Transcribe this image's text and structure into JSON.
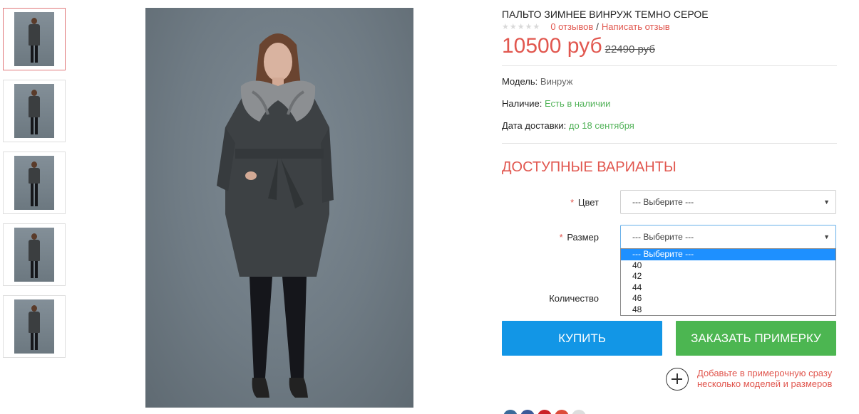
{
  "thumbnails": [
    {
      "alt": "thumb-1",
      "active": true
    },
    {
      "alt": "thumb-2",
      "active": false
    },
    {
      "alt": "thumb-3",
      "active": false
    },
    {
      "alt": "thumb-4",
      "active": false
    },
    {
      "alt": "thumb-5",
      "active": false
    }
  ],
  "product": {
    "title": "ПАЛЬТО ЗИМНЕЕ ВИНРУЖ ТЕМНО СЕРОЕ",
    "stars": "★★★★★",
    "reviews_link": "0 отзывов",
    "separator": "/",
    "write_review_link": "Написать отзыв",
    "price_new": "10500 руб",
    "price_old": "22490 руб"
  },
  "specs": {
    "model_label": "Модель:",
    "model_value": "Винруж",
    "stock_label": "Наличие:",
    "stock_value": "Есть в наличии",
    "delivery_label": "Дата доставки:",
    "delivery_value": "до 18 сентября"
  },
  "options": {
    "section_title": "ДОСТУПНЫЕ ВАРИАНТЫ",
    "required_mark": "*",
    "color_label": "Цвет",
    "color_value": "--- Выберите ---",
    "size_label": "Размер",
    "size_value": "--- Выберите ---",
    "size_options": [
      "--- Выберите ---",
      "40",
      "42",
      "44",
      "46",
      "48"
    ],
    "size_selected_index": 0,
    "quantity_label": "Количество"
  },
  "actions": {
    "buy_label": "КУПИТЬ",
    "try_on_label": "ЗАКАЗАТЬ ПРИМЕРКУ",
    "add_fitting_text": "Добавьте в примерочную сразу несколько моделей и размеров"
  },
  "colors": {
    "accent_red": "#e1574f",
    "buy_blue": "#1296e6",
    "try_green": "#4cb651",
    "stock_green": "#53b35a"
  },
  "social": [
    "twitter-icon",
    "facebook-icon",
    "pinterest-icon",
    "google-plus-icon",
    "share-icon"
  ]
}
